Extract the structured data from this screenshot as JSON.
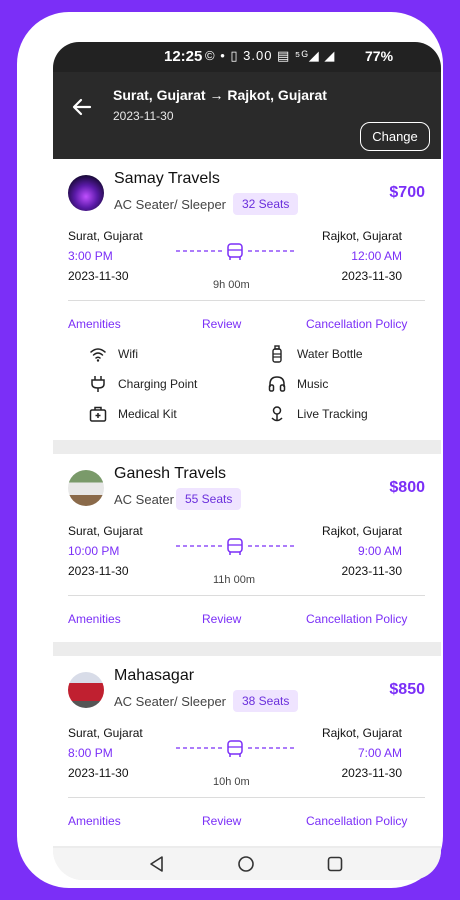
{
  "status_bar": {
    "time": "12:25",
    "icons": "© • ▯ 3.00 ▤ ⁵ᴳ◢ ◢",
    "battery": "77%"
  },
  "header": {
    "route": "Surat, Gujarat → Rajkot, Gujarat",
    "date": "2023-11-30",
    "change_label": "Change"
  },
  "links": {
    "amenities": "Amenities",
    "review": "Review",
    "cancellation": "Cancellation Policy"
  },
  "buses": [
    {
      "name": "Samay Travels",
      "type": "AC Seater/ Sleeper",
      "seats": "32 Seats",
      "price": "$700",
      "from": "Surat, Gujarat",
      "to": "Rajkot, Gujarat",
      "departure": "3:00 PM",
      "arrival": "12:00 AM",
      "dep_date": "2023-11-30",
      "arr_date": "2023-11-30",
      "duration": "9h 00m",
      "amenities": [
        "Wifi",
        "Water Bottle",
        "Charging Point",
        "Music",
        "Medical Kit",
        "Live Tracking"
      ]
    },
    {
      "name": "Ganesh Travels",
      "type": "AC Seater",
      "seats": "55 Seats",
      "price": "$800",
      "from": "Surat, Gujarat",
      "to": "Rajkot, Gujarat",
      "departure": "10:00 PM",
      "arrival": "9:00 AM",
      "dep_date": "2023-11-30",
      "arr_date": "2023-11-30",
      "duration": "11h 00m"
    },
    {
      "name": "Mahasagar",
      "type": "AC Seater/ Sleeper",
      "seats": "38 Seats",
      "price": "$850",
      "from": "Surat, Gujarat",
      "to": "Rajkot, Gujarat",
      "departure": "8:00 PM",
      "arrival": "7:00 AM",
      "dep_date": "2023-11-30",
      "arr_date": "2023-11-30",
      "duration": "10h 0m"
    }
  ],
  "colors": {
    "accent": "#7b2ff7",
    "header_bg": "#2a2a2a",
    "seat_badge_bg": "#efe4ff"
  }
}
